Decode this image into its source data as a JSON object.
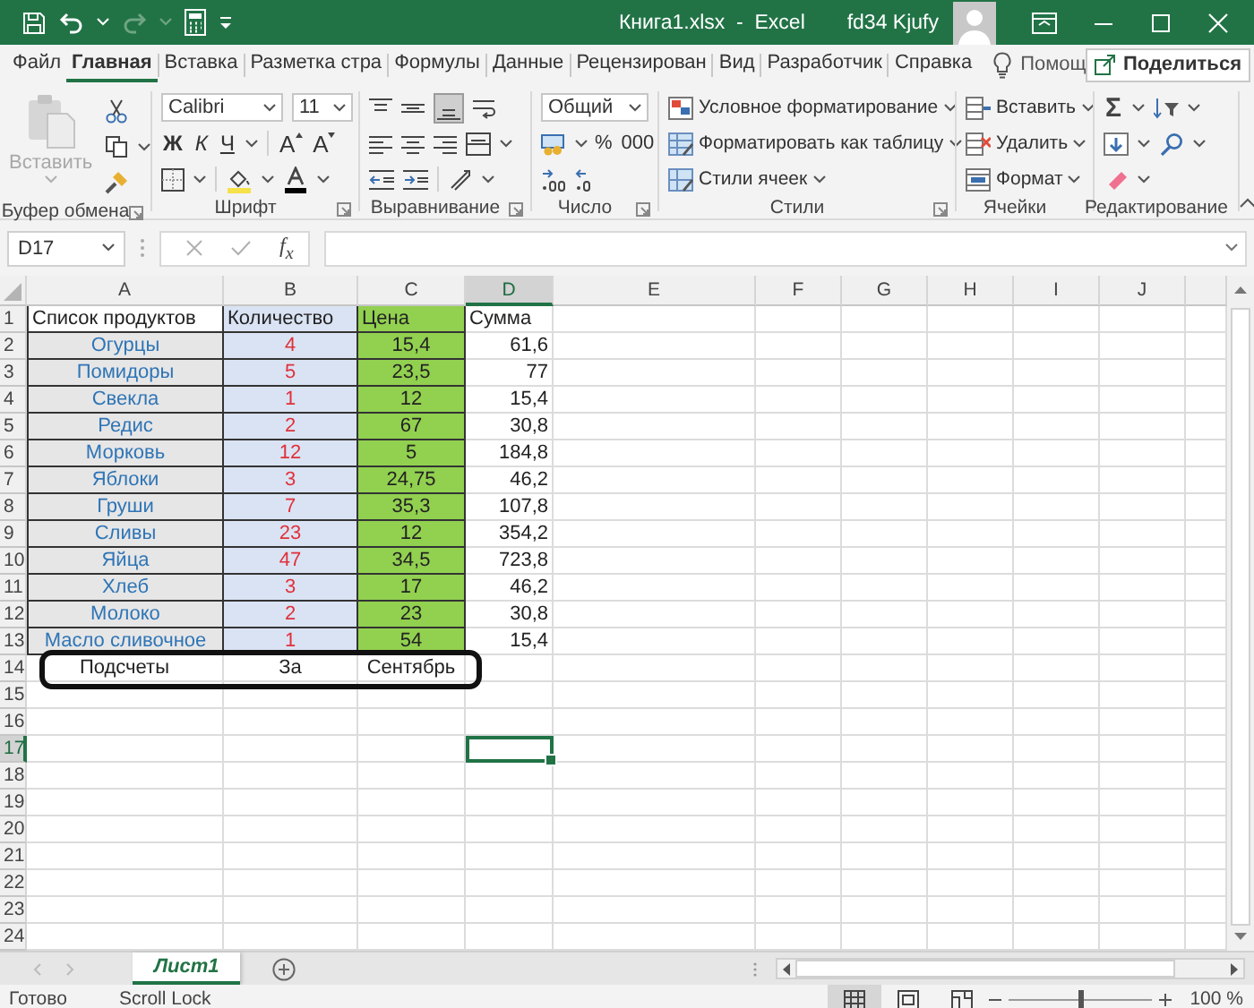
{
  "window": {
    "title": "Книга1.xlsx  -  Excel",
    "user": "fd34 Kjufy"
  },
  "ribbon_tabs": [
    {
      "label": "Файл",
      "selected": false
    },
    {
      "label": "Главная",
      "selected": true
    },
    {
      "label": "Вставка",
      "selected": false
    },
    {
      "label": "Разметка стра",
      "selected": false
    },
    {
      "label": "Формулы",
      "selected": false
    },
    {
      "label": "Данные",
      "selected": false
    },
    {
      "label": "Рецензирован",
      "selected": false
    },
    {
      "label": "Вид",
      "selected": false
    },
    {
      "label": "Разработчик",
      "selected": false
    },
    {
      "label": "Справка",
      "selected": false
    }
  ],
  "tell_me": "Помощ",
  "share_button": "Поделиться",
  "ribbon": {
    "clipboard": {
      "paste": {
        "label": "Вставить",
        "disabled": true
      },
      "caption": "Буфер обмена"
    },
    "font": {
      "font_name": "Calibri",
      "font_size": "11",
      "style_buttons": [
        "Ж",
        "К",
        "Ч"
      ],
      "size_buttons": [
        "A",
        "A"
      ],
      "caption": "Шрифт"
    },
    "alignment": {
      "caption": "Выравнивание"
    },
    "number": {
      "format": "Общий",
      "buttons": [
        "%",
        "000"
      ],
      "caption": "Число"
    },
    "styles": {
      "commands": [
        "Условное форматирование",
        "Форматировать как таблицу",
        "Стили ячеек"
      ],
      "caption": "Стили"
    },
    "cells": {
      "commands": [
        "Вставить",
        "Удалить",
        "Формат"
      ],
      "caption": "Ячейки"
    },
    "editing": {
      "autosum": "Σ",
      "caption": "Редактирование"
    }
  },
  "formula_bar": {
    "name_box": "D17",
    "function_button": "f$_{x}$"
  },
  "sheet": {
    "columns": [
      {
        "label": "A",
        "selected": false
      },
      {
        "label": "B",
        "selected": false
      },
      {
        "label": "C",
        "selected": false
      },
      {
        "label": "D",
        "selected": true
      },
      {
        "label": "E",
        "selected": false
      },
      {
        "label": "F",
        "selected": false
      },
      {
        "label": "G",
        "selected": false
      },
      {
        "label": "H",
        "selected": false
      },
      {
        "label": "I",
        "selected": false
      },
      {
        "label": "J",
        "selected": false
      }
    ],
    "rows": [
      {
        "number": "1",
        "selected": false,
        "kind": "header",
        "cells": [
          "Список продуктов",
          "Количество",
          "Цена",
          "Сумма"
        ]
      },
      {
        "number": "2",
        "selected": false,
        "kind": "item",
        "cells": [
          "Огурцы",
          "4",
          "15,4",
          "61,6"
        ]
      },
      {
        "number": "3",
        "selected": false,
        "kind": "item",
        "cells": [
          "Помидоры",
          "5",
          "23,5",
          "77"
        ]
      },
      {
        "number": "4",
        "selected": false,
        "kind": "item",
        "cells": [
          "Свекла",
          "1",
          "12",
          "15,4"
        ]
      },
      {
        "number": "5",
        "selected": false,
        "kind": "item",
        "cells": [
          "Редис",
          "2",
          "67",
          "30,8"
        ]
      },
      {
        "number": "6",
        "selected": false,
        "kind": "item",
        "cells": [
          "Морковь",
          "12",
          "5",
          "184,8"
        ]
      },
      {
        "number": "7",
        "selected": false,
        "kind": "item",
        "cells": [
          "Яблоки",
          "3",
          "24,75",
          "46,2"
        ]
      },
      {
        "number": "8",
        "selected": false,
        "kind": "item",
        "cells": [
          "Груши",
          "7",
          "35,3",
          "107,8"
        ]
      },
      {
        "number": "9",
        "selected": false,
        "kind": "item",
        "cells": [
          "Сливы",
          "23",
          "12",
          "354,2"
        ]
      },
      {
        "number": "10",
        "selected": false,
        "kind": "item",
        "cells": [
          "Яйца",
          "47",
          "34,5",
          "723,8"
        ]
      },
      {
        "number": "11",
        "selected": false,
        "kind": "item",
        "cells": [
          "Хлеб",
          "3",
          "17",
          "46,2"
        ]
      },
      {
        "number": "12",
        "selected": false,
        "kind": "item",
        "cells": [
          "Молоко",
          "2",
          "23",
          "30,8"
        ]
      },
      {
        "number": "13",
        "selected": false,
        "kind": "item",
        "cells": [
          "Масло сливочное",
          "1",
          "54",
          "15,4"
        ]
      },
      {
        "number": "14",
        "selected": false,
        "kind": "plain",
        "cells": [
          "Подсчеты",
          "За",
          "Сентябрь"
        ]
      },
      {
        "number": "15",
        "selected": false
      },
      {
        "number": "16",
        "selected": false
      },
      {
        "number": "17",
        "selected": true
      },
      {
        "number": "18",
        "selected": false
      },
      {
        "number": "19",
        "selected": false
      },
      {
        "number": "20",
        "selected": false
      },
      {
        "number": "21",
        "selected": false
      },
      {
        "number": "22",
        "selected": false
      },
      {
        "number": "23",
        "selected": false
      },
      {
        "number": "24",
        "selected": false
      }
    ]
  },
  "sheet_tabs": [
    {
      "label": "Лист1",
      "selected": true
    }
  ],
  "status_bar": {
    "items": [
      "Готово",
      "Scroll Lock"
    ],
    "zoom_slider": {
      "level": 0.5
    },
    "zoom": "100 %"
  }
}
